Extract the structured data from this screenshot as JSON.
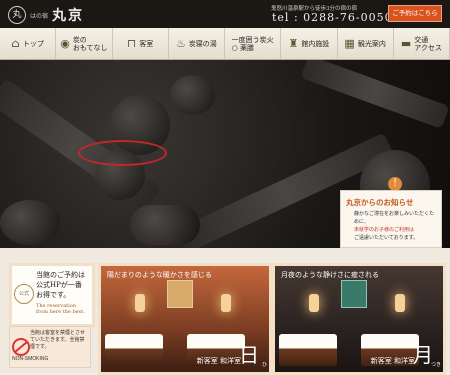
{
  "header": {
    "logo_seal": "丸",
    "logo_small": "はの宿",
    "logo_name": "丸京",
    "access_text": "鬼怒川温泉駅から徒歩3分の宿の宿",
    "tel": "tel : 0288-76-0050",
    "reserve_label": "ご予約はこちら"
  },
  "nav": [
    {
      "label": "トップ",
      "icon": "home-icon"
    },
    {
      "label": "炭の\nおもてなし",
      "icon": "charcoal-icon"
    },
    {
      "label": "客室",
      "icon": "room-icon"
    },
    {
      "label": "炭寝の湯",
      "icon": "bath-icon"
    },
    {
      "label": "一度囲う炭火\n○ 薬膳",
      "icon": "meal-icon"
    },
    {
      "label": "館内施設",
      "icon": "facility-icon"
    },
    {
      "label": "観光案内",
      "icon": "map-icon"
    },
    {
      "label": "交通\nアクセス",
      "icon": "car-icon"
    }
  ],
  "news": {
    "badge": "!",
    "title": "丸京からのお知らせ",
    "line1": "静かなご滞在をお楽しみいただくために、",
    "highlight": "未就学のお子様のご利用は",
    "line2": "ご遠慮いただいております。"
  },
  "promo": {
    "badge": "公式",
    "text": "当館のご予約は公式HPが一番お得です。",
    "en": "The reservation from here the best."
  },
  "nonsmoking": {
    "text": "当館は客室を禁煙とさせていただきます。全館禁煙です。",
    "en": "NON-SMOKING"
  },
  "rooms": [
    {
      "caption": "陽だまりのような暖かさを感じる",
      "label": "新客室 和洋室",
      "char": "日",
      "kana": "ひ"
    },
    {
      "caption": "月夜のような静けさに癒される",
      "label": "新客室 和洋室",
      "char": "月",
      "kana": "つき"
    }
  ]
}
